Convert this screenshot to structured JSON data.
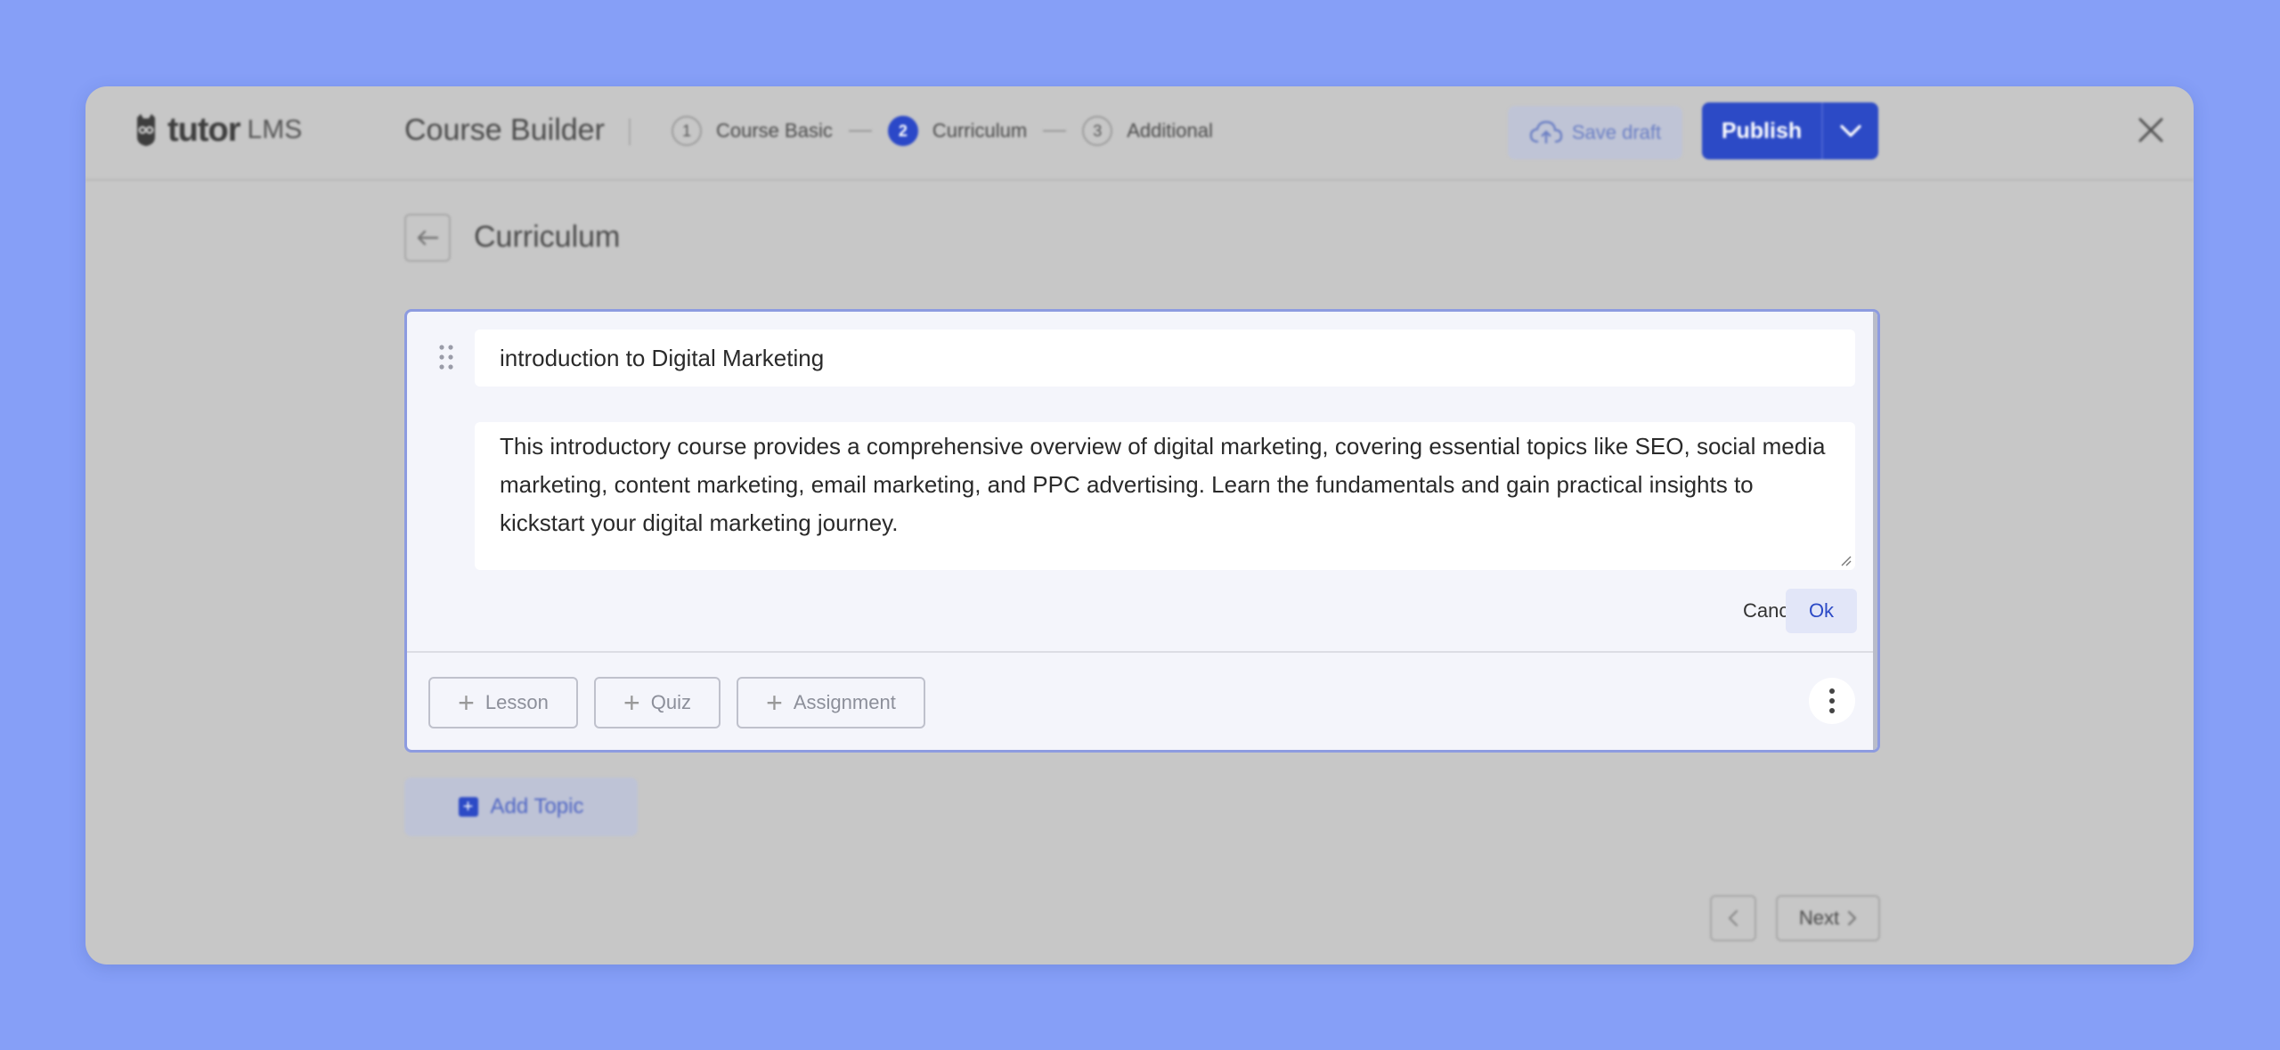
{
  "header": {
    "logo_word": "tutor",
    "logo_suffix": "LMS",
    "builder_title": "Course Builder",
    "steps": [
      {
        "number": "1",
        "label": "Course Basic",
        "active": false
      },
      {
        "number": "2",
        "label": "Curriculum",
        "active": true
      },
      {
        "number": "3",
        "label": "Additional",
        "active": false
      }
    ],
    "save_draft_label": "Save draft",
    "publish_label": "Publish",
    "icons": {
      "logo": "owl-logo-icon",
      "save": "cloud-upload-icon",
      "caret": "chevron-down-icon",
      "close": "close-icon"
    }
  },
  "page": {
    "section_title": "Curriculum",
    "back_icon": "arrow-left-icon"
  },
  "topic": {
    "title_value": "introduction to Digital Marketing",
    "description_value": "This introductory course provides a comprehensive overview of digital marketing, covering essential topics like SEO, social media marketing, content marketing, email marketing, and PPC advertising. Learn the fundamentals and gain practical insights to kickstart your digital marketing journey.",
    "cancel_label": "Cancel",
    "ok_label": "Ok",
    "add_buttons": [
      "Lesson",
      "Quiz",
      "Assignment"
    ],
    "drag_icon": "drag-handle-icon",
    "more_icon": "kebab-menu-icon"
  },
  "footer": {
    "add_topic_label": "Add Topic",
    "next_label": "Next",
    "accent_color": "#2c4ac6"
  }
}
